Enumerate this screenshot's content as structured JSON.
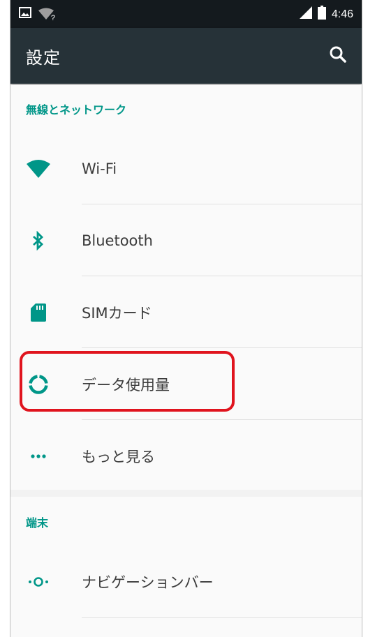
{
  "status_bar": {
    "time": "4:46",
    "wifi_badge": "?"
  },
  "app_bar": {
    "title": "設定"
  },
  "sections": {
    "wireless": {
      "header": "無線とネットワーク",
      "items": [
        {
          "label": "Wi-Fi",
          "icon": "wifi-icon"
        },
        {
          "label": "Bluetooth",
          "icon": "bluetooth-icon"
        },
        {
          "label": "SIMカード",
          "icon": "sim-card-icon"
        },
        {
          "label": "データ使用量",
          "icon": "data-usage-icon"
        },
        {
          "label": "もっと見る",
          "icon": "more-icon"
        }
      ]
    },
    "device": {
      "header": "端末",
      "items": [
        {
          "label": "ナビゲーションバー",
          "icon": "navigation-bar-icon"
        }
      ]
    }
  },
  "colors": {
    "accent": "#009688",
    "app_bar": "#263238",
    "status_bar": "#141a1e",
    "highlight": "#e0141e"
  }
}
